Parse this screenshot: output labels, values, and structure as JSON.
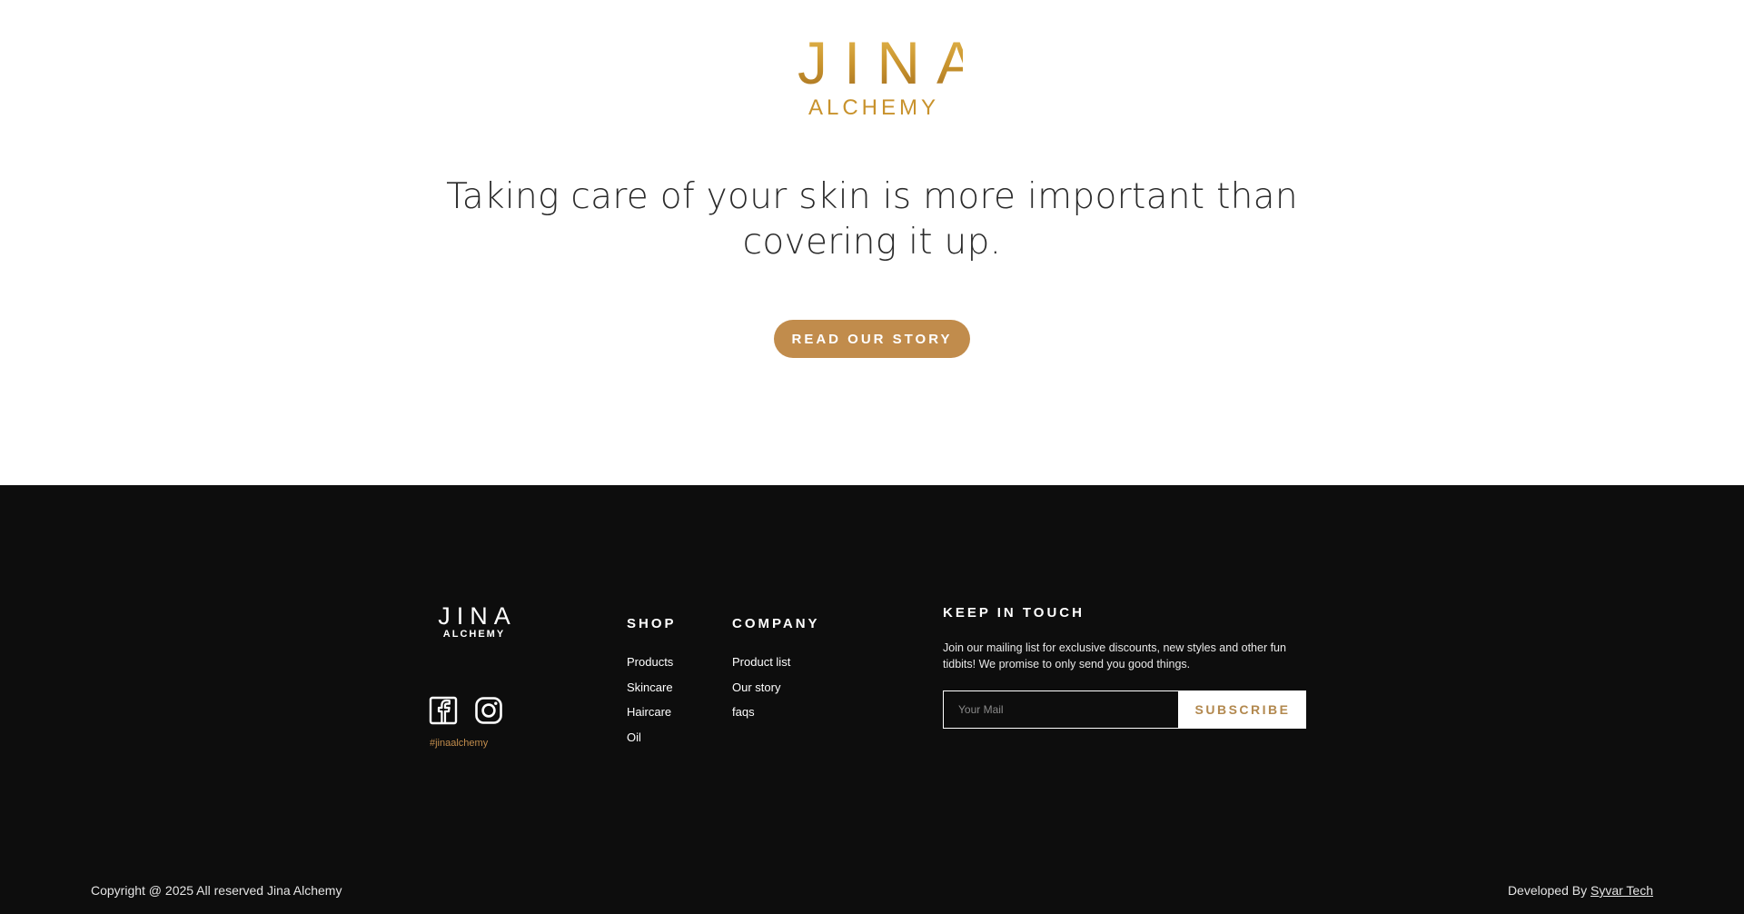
{
  "hero": {
    "logo_word": "JINA",
    "logo_sub": "ALCHEMY",
    "tagline_line1": "Taking care of your skin is more important than",
    "tagline_line2": "covering it up.",
    "story_button": "READ OUR STORY"
  },
  "footer": {
    "logo_word": "JINA",
    "logo_sub": "ALCHEMY",
    "social": [
      "facebook-icon",
      "instagram-icon"
    ],
    "hashtag": "#jinaalchemy",
    "shop": {
      "title": "SHOP",
      "links": [
        "Products",
        "Skincare",
        "Haircare",
        "Oil"
      ]
    },
    "company": {
      "title": "COMPANY",
      "links": [
        "Product list",
        "Our story",
        "faqs"
      ]
    },
    "keep_in_touch": {
      "title": "KEEP IN TOUCH",
      "text": "Join our mailing list for exclusive discounts, new styles and other fun tidbits! We promise to only send you good things.",
      "placeholder": "Your Mail",
      "button": "SUBSCRIBE"
    },
    "copyright": "Copyright @ 2025 All reserved Jina Alchemy",
    "developed_prefix": "Developed By",
    "developed_link": "Syvar Tech"
  },
  "colors": {
    "gold": "#c8922c",
    "button_bg": "#c18c4c",
    "footer_bg": "#0d0d0d"
  }
}
